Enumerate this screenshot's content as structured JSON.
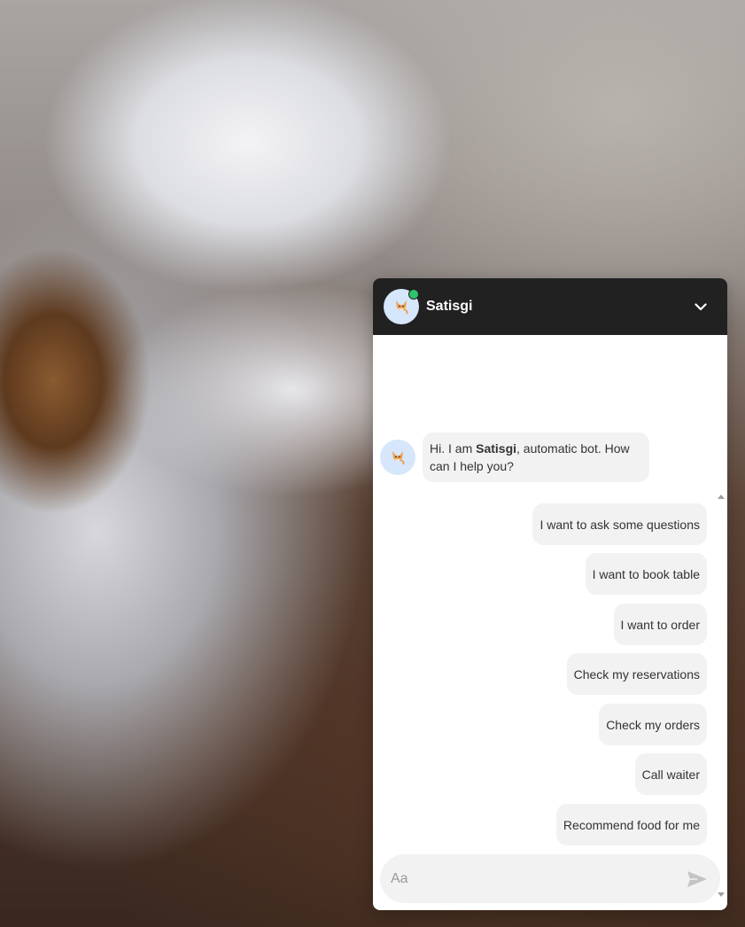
{
  "background": {
    "icon": "cafe-photo"
  },
  "chat": {
    "header": {
      "bot_name": "Satisgi",
      "status_color": "#2fc46a",
      "collapse_icon": "chevron-down-icon"
    },
    "bot_message": {
      "before": "Hi. I am ",
      "name": "Satisgi",
      "after": ", automatic bot. How can I help you?"
    },
    "options": [
      "I want to ask some questions",
      "I want to book table",
      "I want to order",
      "Check my reservations",
      "Check my orders",
      "Call waiter",
      "Recommend food for me"
    ],
    "composer": {
      "placeholder": "Aa",
      "send_icon": "send-icon"
    }
  },
  "colors": {
    "header_bg": "#212121",
    "bubble_bg": "#f2f2f2",
    "avatar_bg": "#d6e6fb"
  }
}
